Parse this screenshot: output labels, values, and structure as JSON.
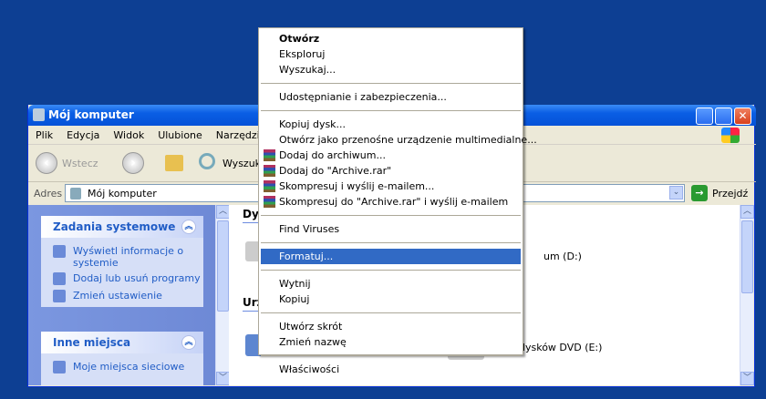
{
  "window": {
    "title": "Mój komputer",
    "controls": [
      "minimize",
      "maximize",
      "close"
    ]
  },
  "menubar": [
    "Plik",
    "Edycja",
    "Widok",
    "Ulubione",
    "Narzędzia"
  ],
  "toolbar": {
    "back": "Wstecz",
    "search": "Wyszukaj"
  },
  "address": {
    "label": "Adres",
    "value": "Mój komputer",
    "go": "Przejdź"
  },
  "left_panel": {
    "system_tasks": {
      "title": "Zadania systemowe",
      "items": [
        "Wyświetl informacje o systemie",
        "Dodaj lub usuń programy",
        "Zmień ustawienie"
      ]
    },
    "other_places": {
      "title": "Inne miejsca",
      "items": [
        "Moje miejsca sieciowe"
      ]
    }
  },
  "content": {
    "section1": "Dys",
    "section2": "Urz",
    "drive_d": "um (D:)",
    "drive_e": "dysków DVD (E:)"
  },
  "context_menu": {
    "items": [
      {
        "label": "Otwórz",
        "bold": true
      },
      {
        "label": "Eksploruj"
      },
      {
        "label": "Wyszukaj..."
      },
      {
        "sep": true
      },
      {
        "label": "Udostępnianie i zabezpieczenia..."
      },
      {
        "sep": true
      },
      {
        "label": "Kopiuj dysk..."
      },
      {
        "label": "Otwórz jako przenośne urządzenie multimedialne..."
      },
      {
        "label": "Dodaj do archiwum...",
        "icon": "winrar-icon"
      },
      {
        "label": "Dodaj do \"Archive.rar\"",
        "icon": "winrar-icon"
      },
      {
        "label": "Skompresuj i wyślij e-mailem...",
        "icon": "winrar-icon"
      },
      {
        "label": "Skompresuj do \"Archive.rar\" i wyślij e-mailem",
        "icon": "winrar-icon"
      },
      {
        "sep": true
      },
      {
        "label": "Find Viruses"
      },
      {
        "sep": true
      },
      {
        "label": "Formatuj...",
        "highlighted": true
      },
      {
        "sep": true
      },
      {
        "label": "Wytnij"
      },
      {
        "label": "Kopiuj"
      },
      {
        "sep": true
      },
      {
        "label": "Utwórz skrót"
      },
      {
        "label": "Zmień nazwę"
      },
      {
        "sep": true
      },
      {
        "label": "Właściwości"
      }
    ]
  },
  "colors": {
    "desktop": "#0d3f93",
    "highlight": "#316ac5",
    "titlebar": "#0a5ee4"
  }
}
